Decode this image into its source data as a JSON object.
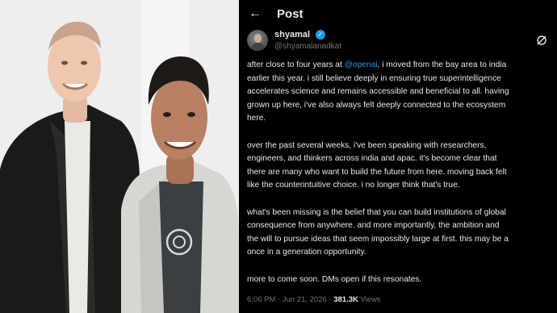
{
  "header": {
    "back_icon": "arrow-left-icon",
    "title": "Post"
  },
  "author": {
    "name": "shyamal",
    "handle": "@shyamalanadkat",
    "verified_icon": "verified-badge-icon",
    "menu_icon": "grok-icon"
  },
  "tweet": {
    "p1_pre": "after close to four years at ",
    "p1_mention": "@openai",
    "p1_post": ", i moved from the bay area to india\nearlier this year. i still believe deeply in ensuring true superintelligence\naccelerates science and remains accessible and beneficial to all. having\ngrown up here, i've also always felt deeply connected to the ecosystem\nhere.",
    "p2": "over the past several weeks, i've been speaking with researchers,\nengineers, and thinkers across india and apac. it's become clear that\nthere are many who want to build the future from here. moving back felt\nlike the counterintuitive choice. i no longer think that's true.",
    "p3": "what's been missing is the belief that you can build institutions of global\nconsequence from anywhere. and more importantly, the ambition and\nthe will to pursue ideas that seem impossibly large at first. this may be a\nonce in a generation opportunity.",
    "p4": "more to come soon. DMs open if this resonates."
  },
  "meta": {
    "time": "6:06 PM",
    "separator": " · ",
    "date": "Jun 21, 2026",
    "views": "381.3K",
    "views_label": " Views"
  },
  "colors": {
    "background": "#000000",
    "text": "#e7e9ea",
    "muted": "#71767b",
    "accent": "#1d9bf0"
  }
}
